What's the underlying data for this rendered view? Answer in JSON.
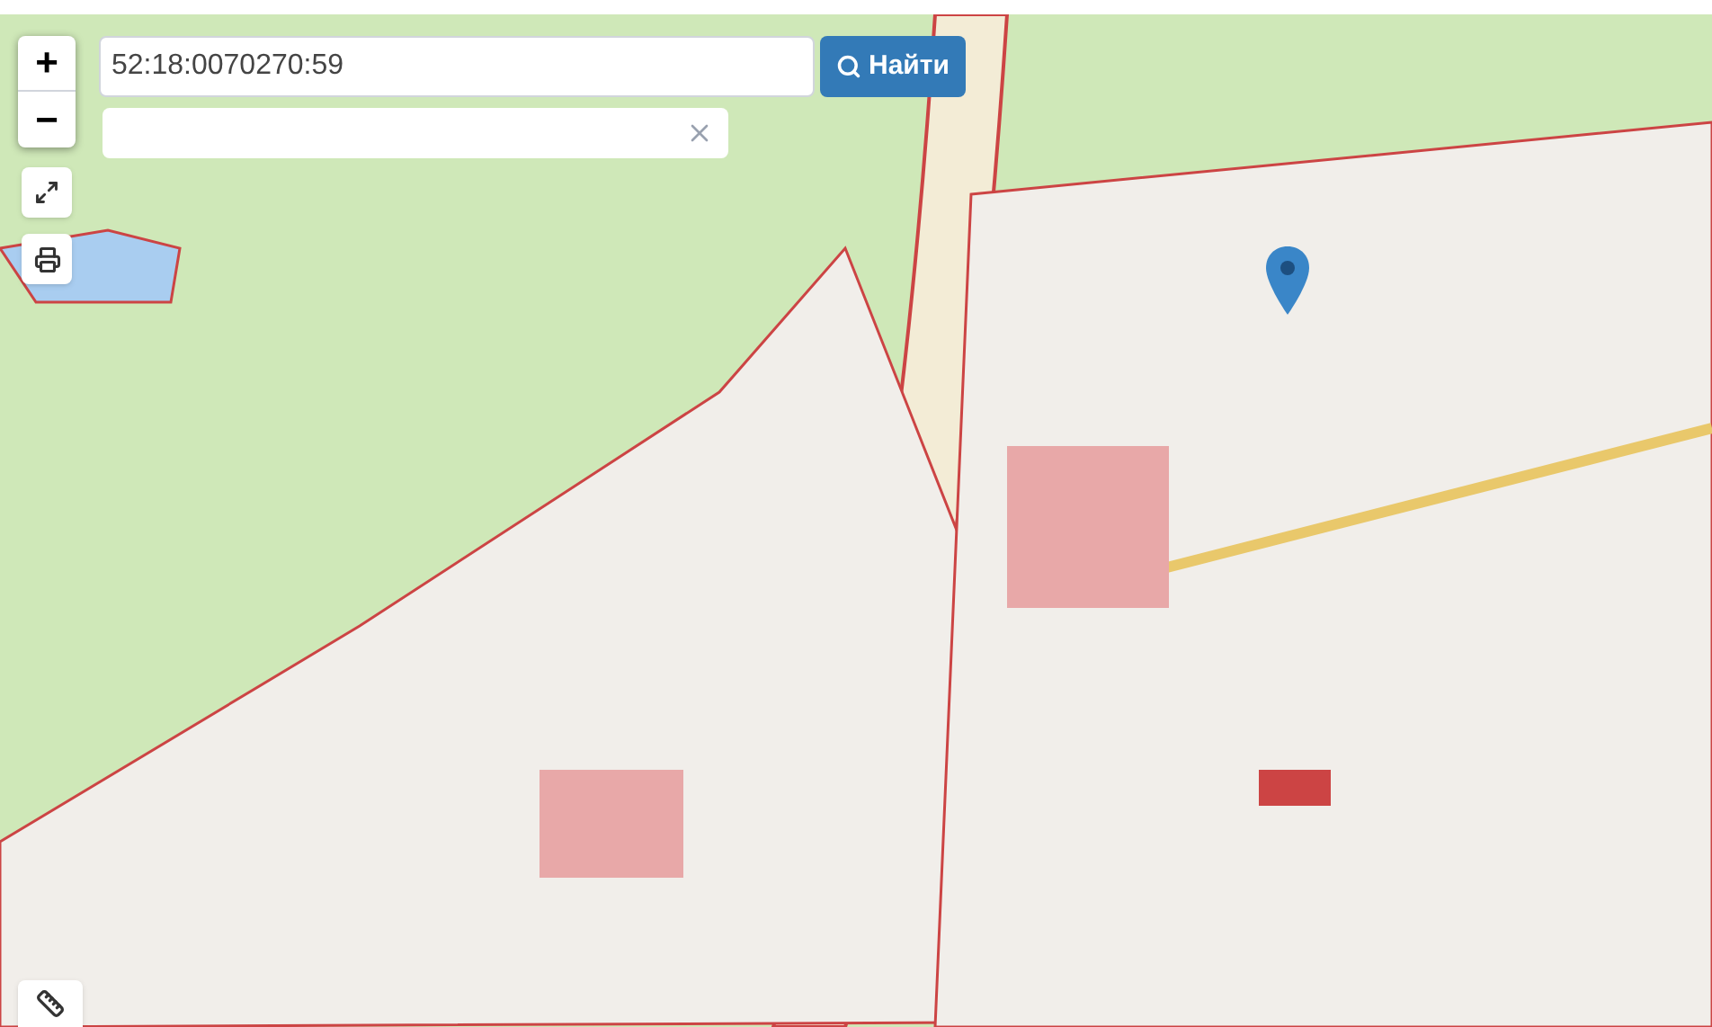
{
  "zoom": {
    "zoom_in": "+",
    "zoom_out": "−"
  },
  "search": {
    "value": "52:18:0070270:59",
    "button": "Найти"
  },
  "address_field": {
    "clearable": true
  },
  "map": {
    "marker": true
  }
}
